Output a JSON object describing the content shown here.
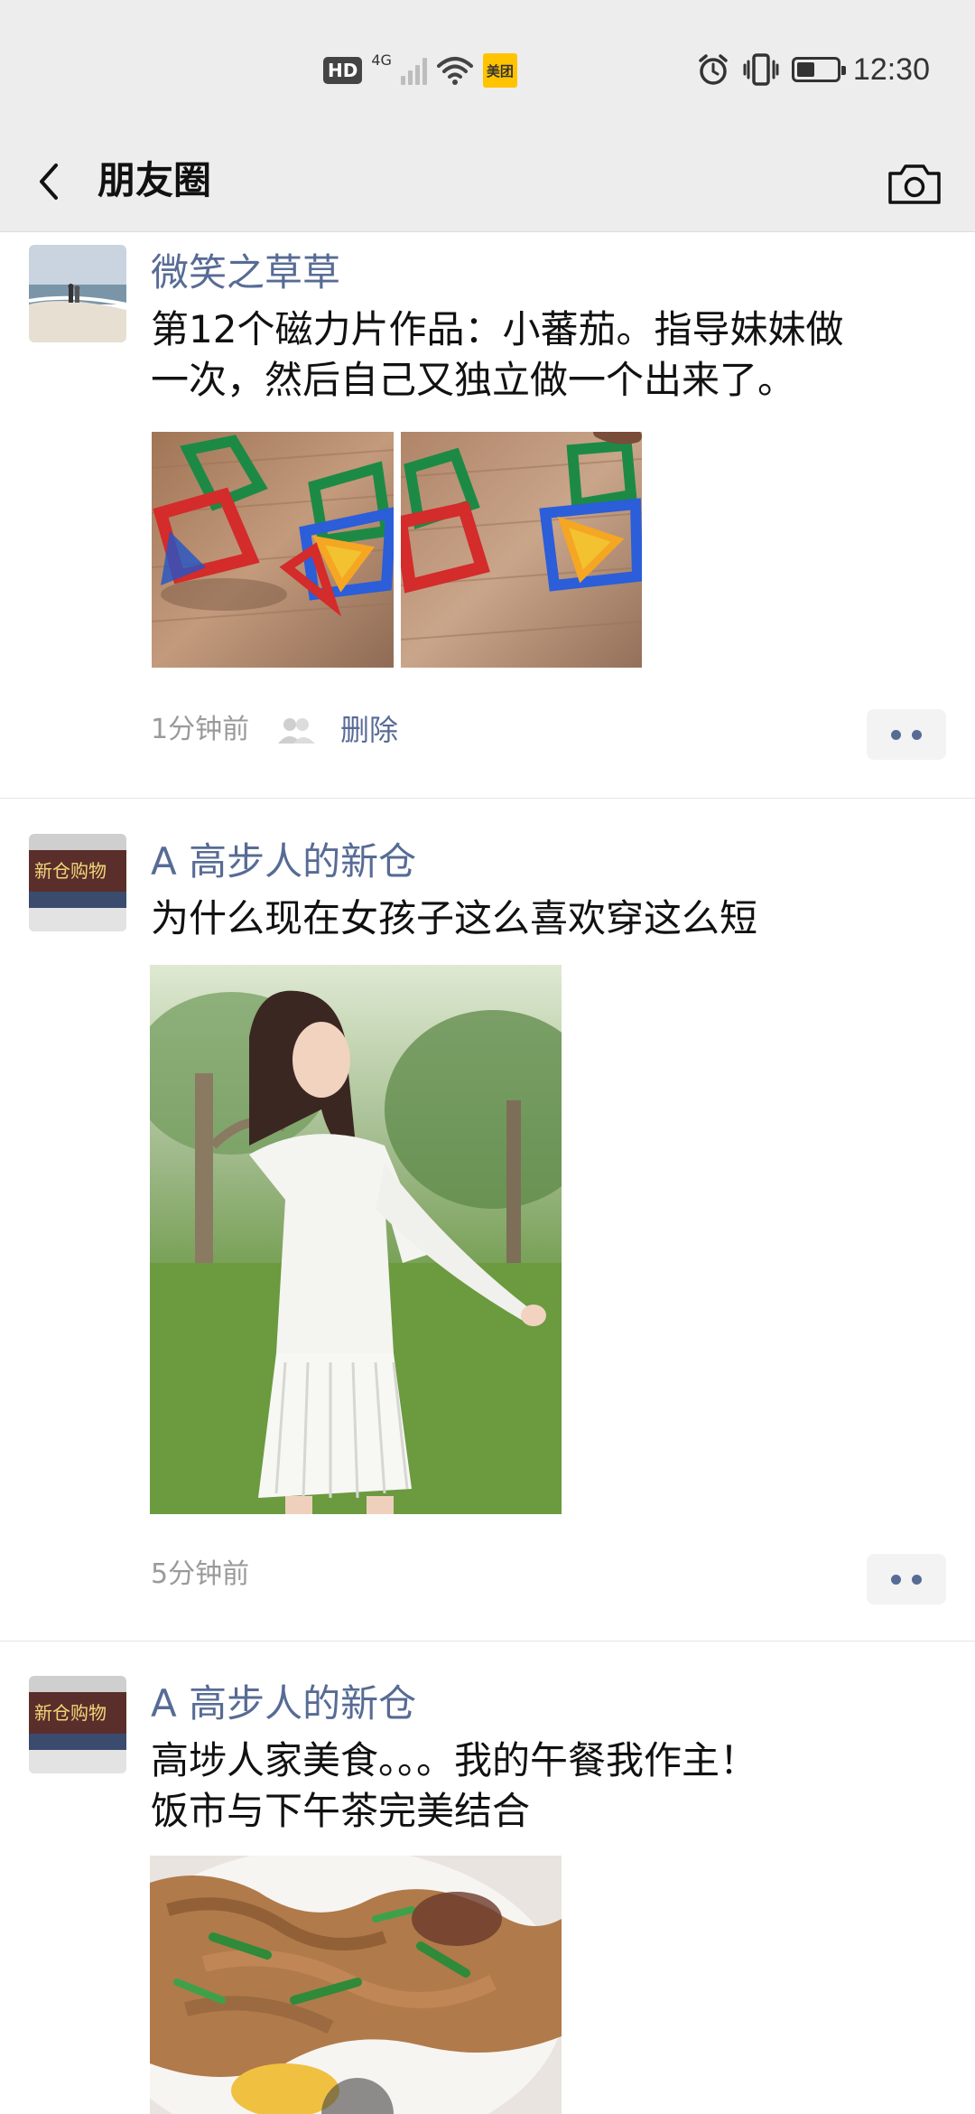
{
  "status_bar": {
    "hd": "HD",
    "network": "4G",
    "app_badge": "美团",
    "time": "12:30",
    "battery_level": 0.45
  },
  "nav": {
    "title": "朋友圈"
  },
  "posts": [
    {
      "author": "微笑之草草",
      "text_lines": [
        "第12个磁力片作品：小蕃茄。指导妹妹做",
        "一次，然后自己又独立做一个出来了。"
      ],
      "time": "1分钟前",
      "delete_label": "删除"
    },
    {
      "author": "A   高步人的新仓",
      "text_lines": [
        "为什么现在女孩子这么喜欢穿这么短"
      ],
      "time": "5分钟前"
    },
    {
      "author": "A   高步人的新仓",
      "text_lines": [
        "高埗人家美食。。。我的午餐我作主！",
        "饭市与下午茶完美结合"
      ]
    }
  ],
  "icons": [
    "back-arrow-icon",
    "camera-icon",
    "alarm-icon",
    "vibrate-icon",
    "wifi-icon",
    "signal-icon",
    "battery-icon",
    "friends-visibility-icon",
    "more-dots-icon"
  ],
  "colors": {
    "link_blue": "#576b95",
    "nav_bg": "#ededed"
  }
}
